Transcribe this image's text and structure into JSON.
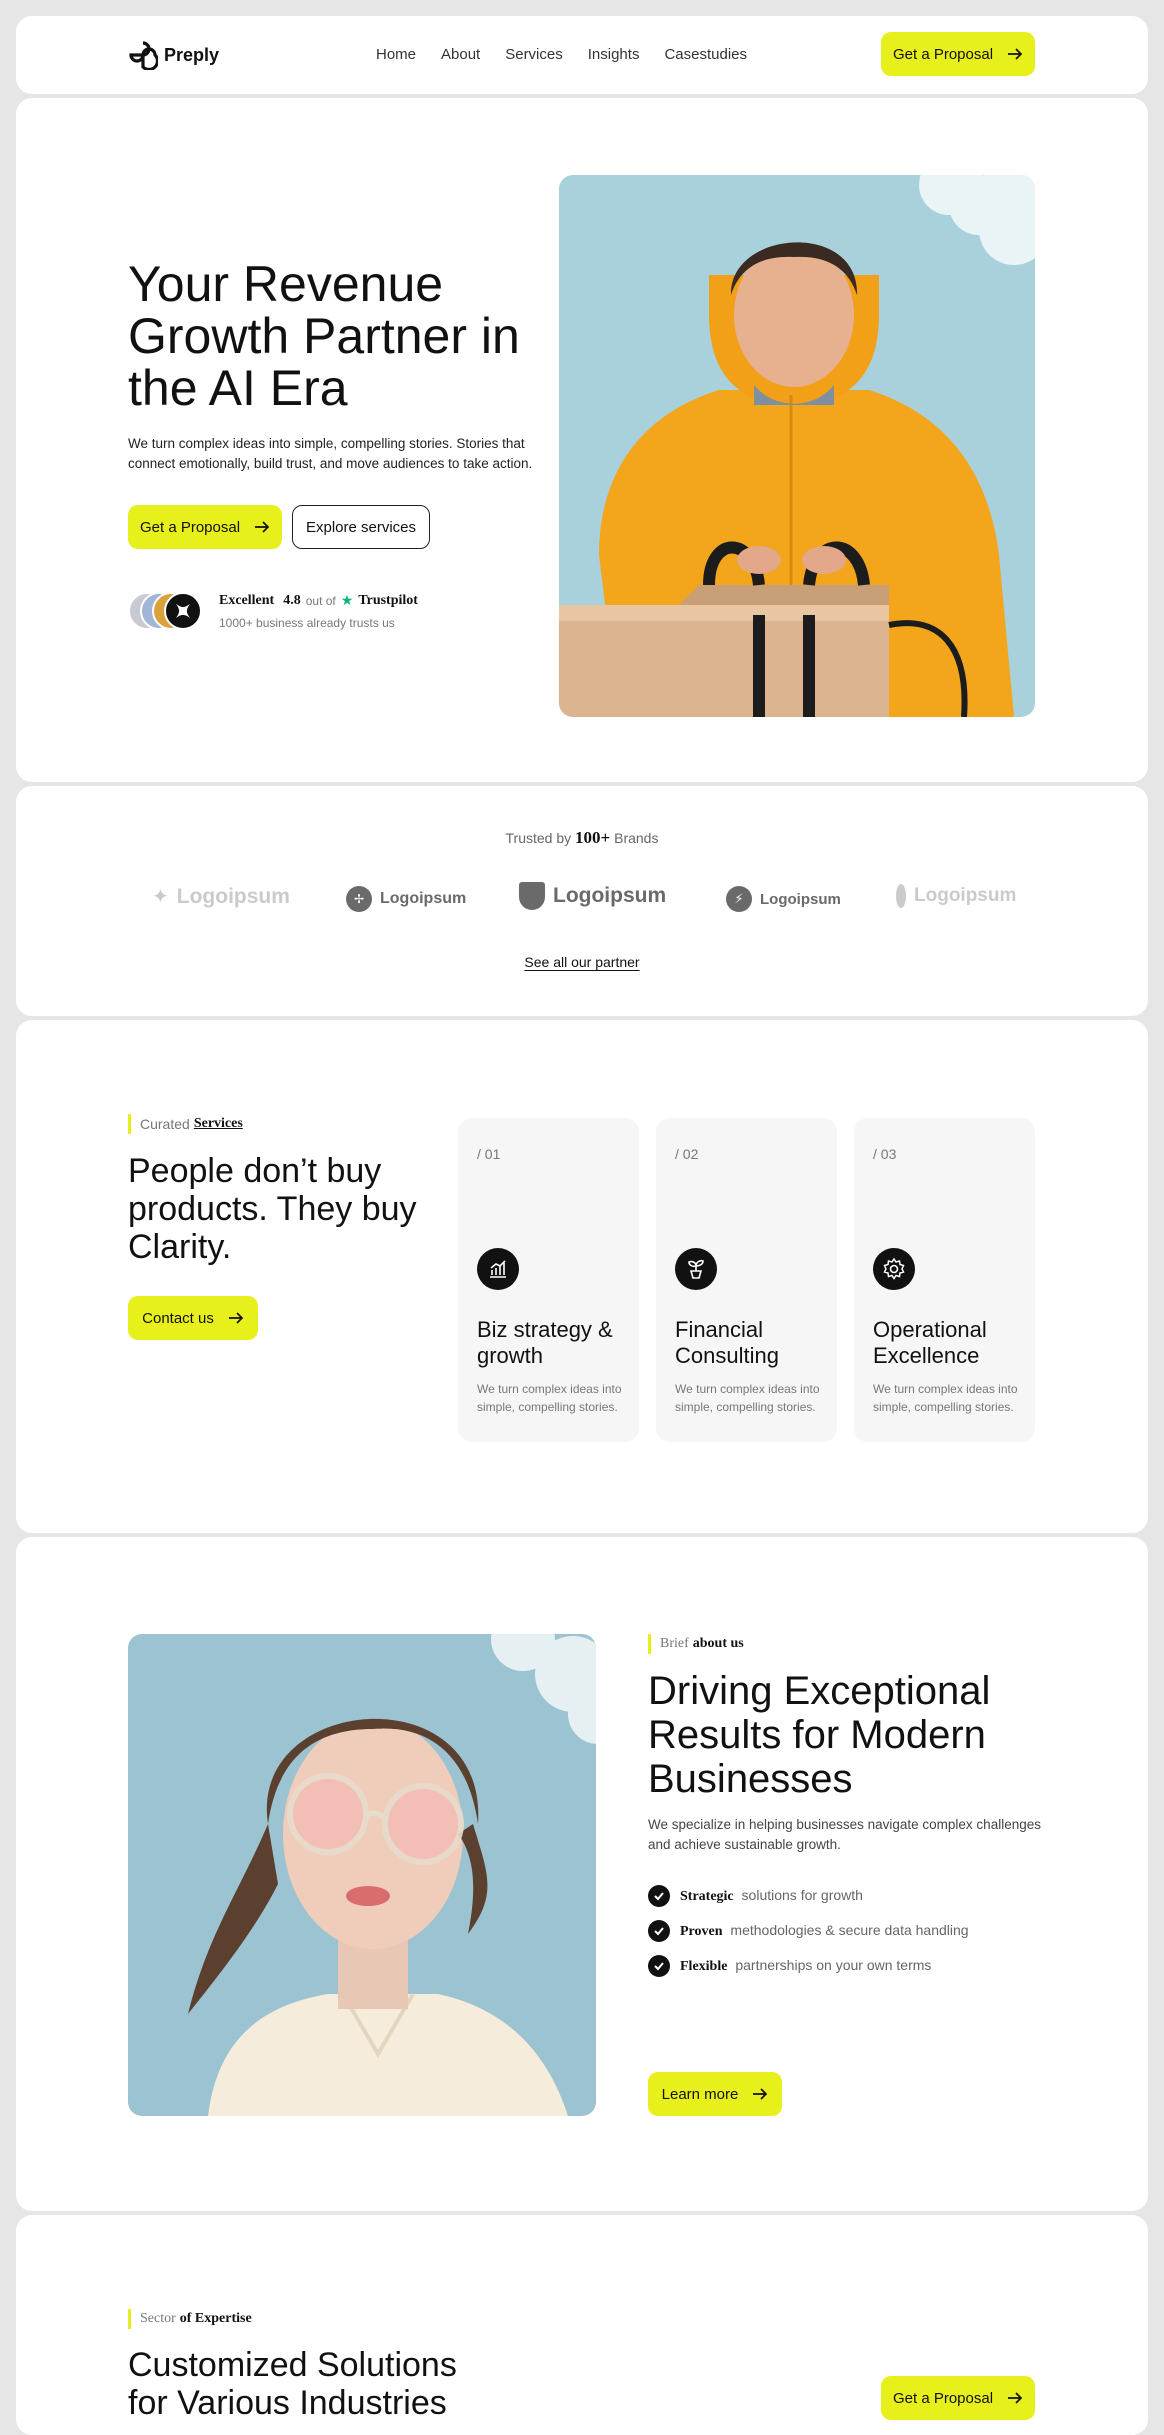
{
  "nav": {
    "brand": "Preply",
    "links": [
      "Home",
      "About",
      "Services",
      "Insights",
      "Casestudies"
    ],
    "cta": "Get a Proposal"
  },
  "hero": {
    "title": "Your Revenue Growth Partner in the AI Era",
    "subtitle": "We turn complex ideas into simple, compelling stories. Stories that connect emotionally, build trust, and move audiences to take action.",
    "primary_cta": "Get a Proposal",
    "secondary_cta": "Explore services",
    "rating_word": "Excellent",
    "rating_value": "4.8",
    "rating_suffix": "out of",
    "rating_brand": "Trustpilot",
    "trust_text": "1000+ business already trusts us"
  },
  "brands": {
    "prefix": "Trusted by",
    "count": "100+",
    "suffix": "Brands",
    "logos": [
      "Logoipsum",
      "Logoipsum",
      "Logoipsum",
      "Logoipsum",
      "Logoipsum"
    ],
    "link": "See all our partner"
  },
  "services": {
    "tag_light": "Curated",
    "tag_bold": "Services",
    "title": "People don’t buy products. They buy Clarity.",
    "cta": "Contact us",
    "cards": [
      {
        "num": "/ 01",
        "icon": "bar-chart-icon",
        "title": "Biz strategy & growth",
        "desc": "We turn complex ideas into simple, compelling stories."
      },
      {
        "num": "/ 02",
        "icon": "sprout-icon",
        "title": "Financial Consulting",
        "desc": "We turn complex ideas into simple, compelling stories."
      },
      {
        "num": "/ 03",
        "icon": "gear-icon",
        "title": "Operational Excellence",
        "desc": "We turn complex ideas into simple, compelling stories."
      }
    ]
  },
  "about": {
    "tag_light": "Brief",
    "tag_bold": "about us",
    "title": "Driving Exceptional Results for Modern Businesses",
    "subtitle": "We specialize in helping businesses navigate complex challenges and achieve sustainable growth.",
    "points": [
      {
        "bold": "Strategic",
        "text": "solutions for growth"
      },
      {
        "bold": "Proven",
        "text": "methodologies & secure data handling"
      },
      {
        "bold": "Flexible",
        "text": "partnerships on your own terms"
      }
    ],
    "cta": "Learn more"
  },
  "expertise": {
    "tag_light": "Sector",
    "tag_bold": "of Expertise",
    "title": "Customized Solutions for Various Industries",
    "cta": "Get a Proposal"
  },
  "colors": {
    "accent": "#e8f01c",
    "dark": "#111111",
    "sky": "#a6d0db",
    "jacket": "#f3a51c"
  }
}
